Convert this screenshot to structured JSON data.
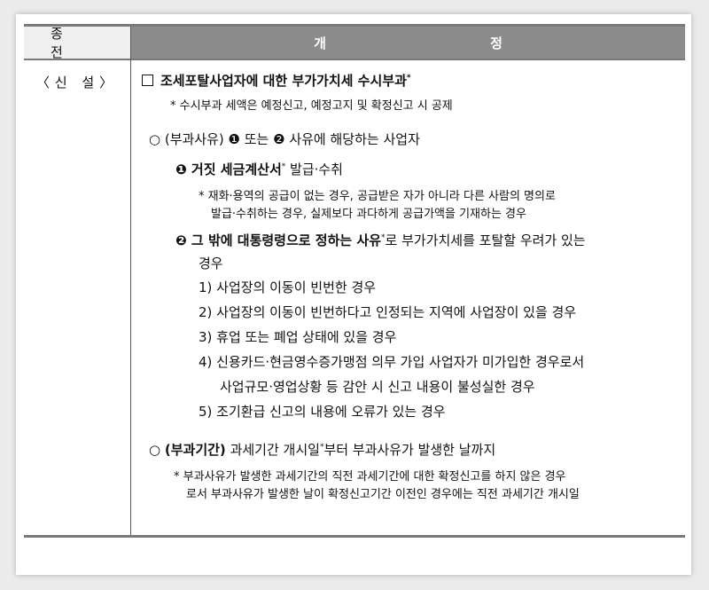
{
  "header": {
    "before": "종 전",
    "after": "개 정"
  },
  "left": {
    "label": "〈신 설〉"
  },
  "items": {
    "title": {
      "marker": "",
      "text": "조세포탈사업자에 대한 부가가치세 수시부과",
      "sup": "*"
    },
    "title_note": "* 수시부과 세액은 예정신고, 예정고지 및 확정신고 시 공제",
    "reason_head": "○ (부과사유) ❶ 또는 ❷ 사유에 해당하는 사업자",
    "r1_title": "❶ 거짓 세금계산서",
    "r1_sup": "*",
    "r1_tail": " 발급·수취",
    "r1_note1": "* 재화·용역의 공급이 없는 경우, 공급받은 자가 아니라 다른 사람의 명의로",
    "r1_note2": "발급·수취하는 경우, 실제보다 과다하게 공급가액을 기재하는 경우",
    "r2_title": "❷ 그 밖에 대통령령으로 정하는 사유",
    "r2_sup": "*",
    "r2_tail": "로 부가가치세를 포탈할 우려가 있는",
    "r2_tail2": "경우",
    "list": [
      "1) 사업장의 이동이 빈번한 경우",
      "2) 사업장의 이동이 빈번하다고 인정되는 지역에 사업장이 있을 경우",
      "3) 휴업 또는 폐업 상태에 있을 경우",
      "4) 신용카드·현금영수증가맹점 의무 가입 사업자가 미가입한 경우로서",
      "사업규모·영업상황 등 감안 시 신고 내용이 불성실한 경우",
      "5) 조기환급 신고의 내용에 오류가 있는 경우"
    ],
    "period_marker": "○",
    "period_title": "(부과기간)",
    "period_tail": " 과세기간 개시일",
    "period_sup": "*",
    "period_tail2": "부터 부과사유가 발생한 날까지",
    "period_note1": "* 부과사유가 발생한 과세기간의 직전 과세기간에 대한 확정신고를 하지 않은 경우",
    "period_note2": "로서 부과사유가 발생한 날이 확정신고기간 이전인 경우에는 직전 과세기간 개시일"
  }
}
